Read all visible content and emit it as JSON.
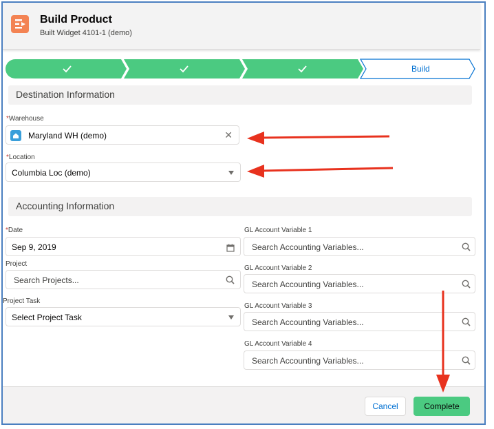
{
  "header": {
    "title": "Build Product",
    "subtitle": "Built Widget 4101-1 (demo)",
    "icon": "build-product-icon"
  },
  "path": {
    "current_step_label": "Build",
    "completed_steps": 3,
    "complete_color": "#4bca81",
    "current_color": "#0070d2"
  },
  "destination": {
    "section_title": "Destination Information",
    "warehouse": {
      "required_mark": "*",
      "label": "Warehouse",
      "value": "Maryland WH (demo)",
      "icon": "warehouse-icon"
    },
    "location": {
      "required_mark": "*",
      "label": "Location",
      "value": "Columbia Loc (demo)"
    }
  },
  "accounting": {
    "section_title": "Accounting Information",
    "date": {
      "required_mark": "*",
      "label": "Date",
      "value": "Sep 9, 2019"
    },
    "project": {
      "label": "Project",
      "placeholder": "Search Projects..."
    },
    "project_task": {
      "label": "Project Task",
      "placeholder": "Select Project Task"
    },
    "gl_variables": [
      {
        "label": "GL Account Variable 1",
        "placeholder": "Search Accounting Variables..."
      },
      {
        "label": "GL Account Variable 2",
        "placeholder": "Search Accounting Variables..."
      },
      {
        "label": "GL Account Variable 3",
        "placeholder": "Search Accounting Variables..."
      },
      {
        "label": "GL Account Variable 4",
        "placeholder": "Search Accounting Variables..."
      }
    ]
  },
  "footer": {
    "cancel_label": "Cancel",
    "complete_label": "Complete"
  },
  "annotation_color": "#e8321e"
}
